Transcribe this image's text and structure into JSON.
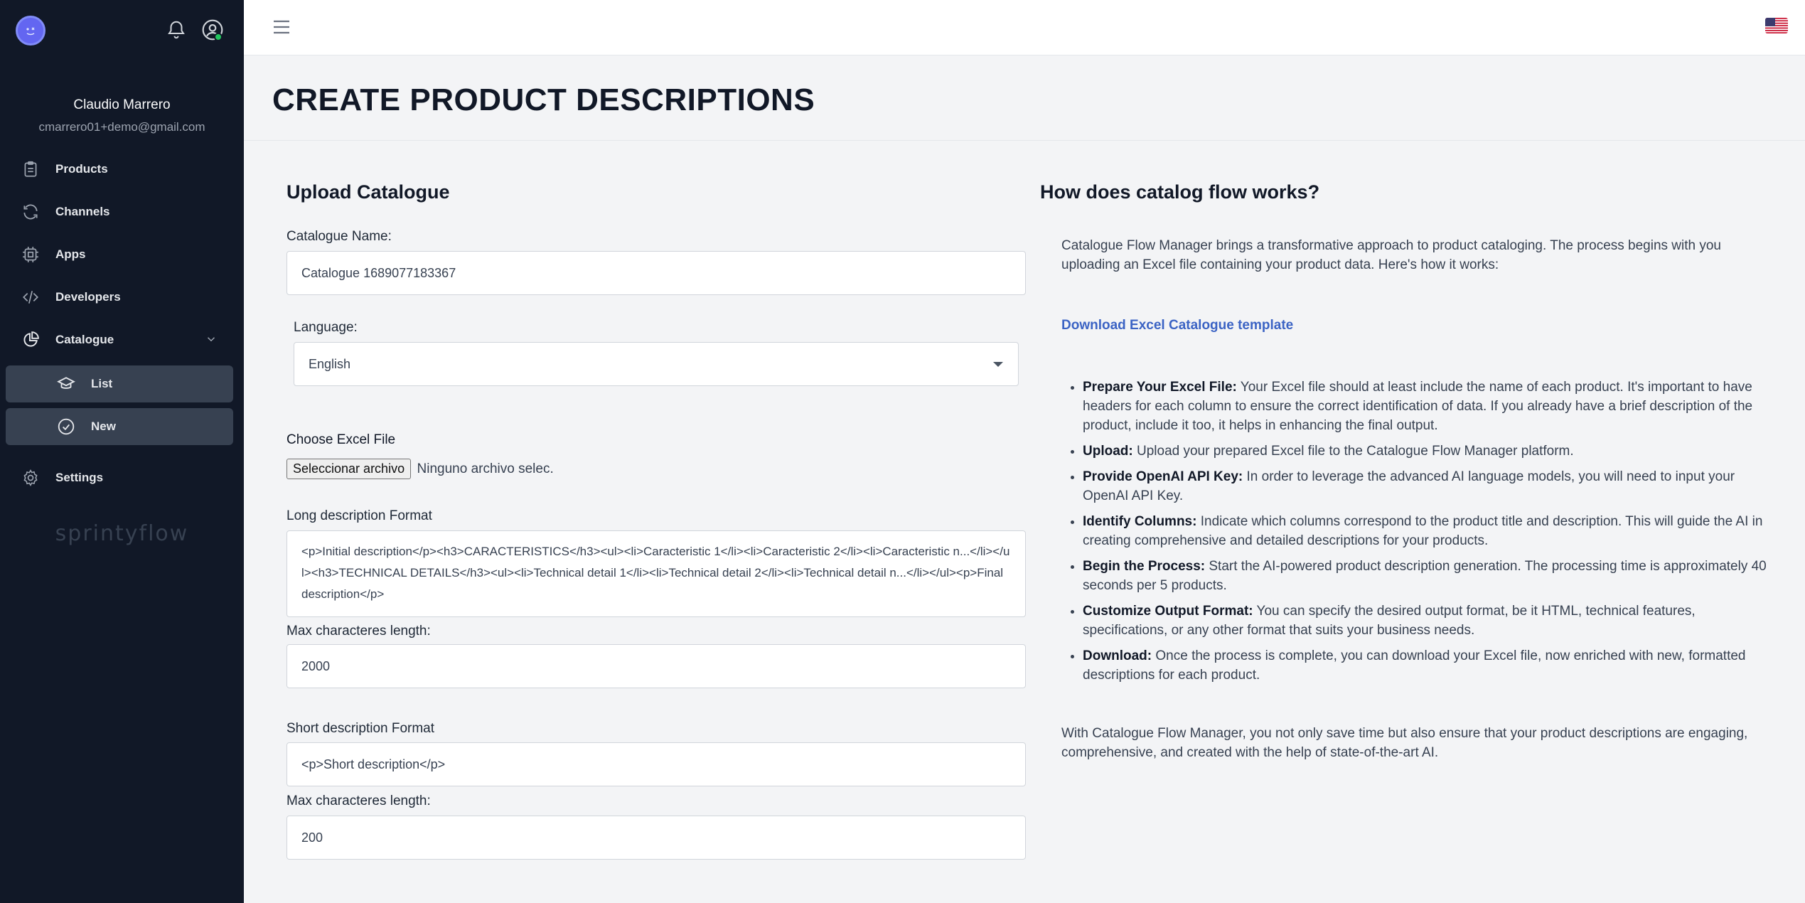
{
  "sidebar": {
    "user_name": "Claudio Marrero",
    "user_email": "cmarrero01+demo@gmail.com",
    "items": [
      {
        "label": "Products",
        "icon": "clipboard-icon"
      },
      {
        "label": "Channels",
        "icon": "refresh-icon"
      },
      {
        "label": "Apps",
        "icon": "chip-icon"
      },
      {
        "label": "Developers",
        "icon": "code-icon"
      },
      {
        "label": "Catalogue",
        "icon": "pie-chart-icon"
      },
      {
        "label": "List",
        "icon": "graduation-cap-icon"
      },
      {
        "label": "New",
        "icon": "check-circle-icon"
      },
      {
        "label": "Settings",
        "icon": "gear-icon"
      }
    ],
    "brand": "sprintyflow"
  },
  "header": {
    "title": "CREATE PRODUCT DESCRIPTIONS"
  },
  "form": {
    "section_title": "Upload Catalogue",
    "catalogue_name_label": "Catalogue Name:",
    "catalogue_name_value": "Catalogue 1689077183367",
    "language_label": "Language:",
    "language_value": "English",
    "file_label": "Choose Excel File",
    "file_button": "Seleccionar archivo",
    "file_status": "Ninguno archivo selec.",
    "long_format_label": "Long description Format",
    "long_format_value": "<p>Initial description</p><h3>CARACTERISTICS</h3><ul><li>Caracteristic 1</li><li>Caracteristic 2</li><li>Caracteristic n...</li></ul><h3>TECHNICAL DETAILS</h3><ul><li>Technical detail 1</li><li>Technical detail 2</li><li>Technical detail n...</li></ul><p>Final description</p>",
    "long_max_label": "Max characteres length:",
    "long_max_value": "2000",
    "short_format_label": "Short description Format",
    "short_format_value": "<p>Short description</p>",
    "short_max_label": "Max characteres length:",
    "short_max_value": "200"
  },
  "help": {
    "title": "How does catalog flow works?",
    "intro": "Catalogue Flow Manager brings a transformative approach to product cataloging. The process begins with you uploading an Excel file containing your product data. Here's how it works:",
    "download_link": "Download Excel Catalogue template",
    "steps": [
      {
        "title": "Prepare Your Excel File:",
        "text": " Your Excel file should at least include the name of each product. It's important to have headers for each column to ensure the correct identification of data. If you already have a brief description of the product, include it too, it helps in enhancing the final output."
      },
      {
        "title": "Upload:",
        "text": " Upload your prepared Excel file to the Catalogue Flow Manager platform."
      },
      {
        "title": "Provide OpenAI API Key:",
        "text": " In order to leverage the advanced AI language models, you will need to input your OpenAI API Key."
      },
      {
        "title": "Identify Columns:",
        "text": " Indicate which columns correspond to the product title and description. This will guide the AI in creating comprehensive and detailed descriptions for your products."
      },
      {
        "title": "Begin the Process:",
        "text": " Start the AI-powered product description generation. The processing time is approximately 40 seconds per 5 products."
      },
      {
        "title": "Customize Output Format:",
        "text": " You can specify the desired output format, be it HTML, technical features, specifications, or any other format that suits your business needs."
      },
      {
        "title": "Download:",
        "text": " Once the process is complete, you can download your Excel file, now enriched with new, formatted descriptions for each product."
      }
    ],
    "outro": "With Catalogue Flow Manager, you not only save time but also ensure that your product descriptions are engaging, comprehensive, and created with the help of state-of-the-art AI."
  }
}
